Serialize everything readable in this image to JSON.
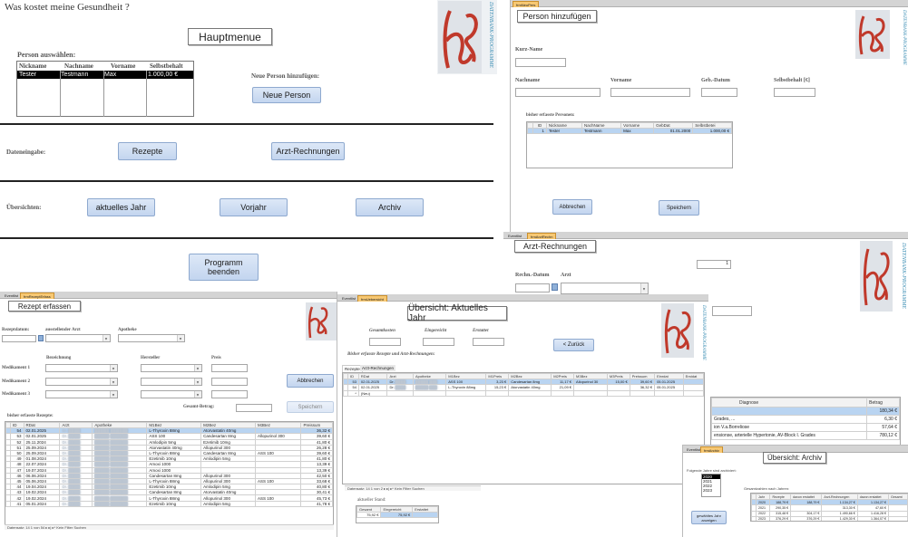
{
  "main": {
    "question": "Was kostet meine Gesundheit ?",
    "menu_title": "Hauptmenue",
    "person_label": "Person auswählen:",
    "person_columns": [
      "Nickname",
      "Nachname",
      "Vorname",
      "Selbstbehalt"
    ],
    "person_rows": [
      [
        "Tester",
        "Testmann",
        "Max",
        "1.000,00 €"
      ]
    ],
    "new_person_label": "Neue Person hinzufügen:",
    "new_person_button": "Neue Person",
    "data_entry_label": "Dateneingabe:",
    "recipes_button": "Rezepte",
    "doctor_bills_button": "Arzt-Rechnungen",
    "overviews_label": "Übersichten:",
    "current_year_button": "aktuelles Jahr",
    "prev_year_button": "Vorjahr",
    "archive_button": "Archiv",
    "quit_button": "Programm beenden"
  },
  "logo": {
    "text": "DATENBANK-PROGRAMME",
    "color": "#c0392b",
    "text_color": "#3d8fb5"
  },
  "person_form": {
    "tab": "frmNeuPers",
    "title": "Person hinzufügen",
    "kurzname_label": "Kurz-Name",
    "nachname_label": "Nachname",
    "vorname_label": "Vorname",
    "geb_label": "Geb.-Datum",
    "selbst_label": "Selbstbehalt [€]",
    "existing_label": "bisher erfasste Personen:",
    "columns": [
      "ID",
      "Nickname",
      "NachName",
      "Vorname",
      "GebDat",
      "Selbstbetei"
    ],
    "row": [
      "1",
      "Tester",
      "Testmann",
      "Max",
      "01.01.2000",
      "1.000,00 €"
    ],
    "cancel": "Abbrechen",
    "save": "Speichern"
  },
  "arzt_form": {
    "tabs": [
      "Eventlist",
      "frmArztRechn"
    ],
    "title": "Arzt-Rechnungen",
    "counter": "1",
    "date_label": "Rechn.-Datum",
    "doctor_label": "Arzt"
  },
  "rezept_form": {
    "tabs": [
      "Eventlist",
      "frmRezeptErfass"
    ],
    "title": "Rezept erfassen",
    "date_label": "Rezeptdatum:",
    "doctor_label": "ausstellender Arzt",
    "pharmacy_label": "Apotheke",
    "name_label": "Bezeichnung",
    "maker_label": "Hersteller",
    "price_label": "Preis",
    "med1": "Medikament 1",
    "med2": "Medikament 2",
    "med3": "Medikament 3",
    "total_label": "Gesamt-Betrag:",
    "cancel": "Abbrechen",
    "save": "Speichern",
    "existing_label": "bisher erfasste Rezepte:",
    "columns": [
      "ID",
      "RDat",
      "Arzt",
      "Apotheke",
      "M1Bez",
      "M2Bez",
      "M3Bez",
      "Preissum"
    ],
    "rows": [
      [
        "54",
        "02.01.2025",
        "Dr.",
        "",
        "L-Thyroxin 88mg",
        "Atorvastatin 40mg",
        "",
        "36,32 €"
      ],
      [
        "53",
        "02.01.2025",
        "Dr.",
        "",
        "ASS 100",
        "Candesartan 8mg",
        "Allopurinol 300",
        "39,60 €"
      ],
      [
        "52",
        "25.11.2024",
        "Dr.",
        "",
        "Amlodipin 5mg",
        "Ezetimib 10mg",
        "",
        "41,80 €"
      ],
      [
        "51",
        "25.09.2024",
        "Dr.",
        "",
        "Atorvastatin 40mg",
        "Allopurinol 300",
        "",
        "26,28 €"
      ],
      [
        "50",
        "25.09.2024",
        "Dr.",
        "",
        "L-Thyroxin 88mg",
        "Candesartan 8mg",
        "ASS 100",
        "39,60 €"
      ],
      [
        "49",
        "01.08.2024",
        "Dr.",
        "",
        "Ezetimib 10mg",
        "Amlodipin 5mg",
        "",
        "41,80 €"
      ],
      [
        "48",
        "22.07.2024",
        "Dr.",
        "",
        "Amoxi 1000",
        "",
        "",
        "13,39 €"
      ],
      [
        "47",
        "19.07.2024",
        "Dr.",
        "",
        "Amoxi 1000",
        "",
        "",
        "13,39 €"
      ],
      [
        "46",
        "06.06.2024",
        "Dr.",
        "",
        "Candesartan 8mg",
        "Allopurinol 300",
        "",
        "42,50 €"
      ],
      [
        "45",
        "05.06.2024",
        "Dr.",
        "",
        "L-Thyroxin 88mg",
        "Allopurinol 300",
        "ASS 100",
        "33,68 €"
      ],
      [
        "44",
        "19.04.2024",
        "Dr.",
        "",
        "Ezetimib 10mg",
        "Amlodipin 5mg",
        "",
        "40,80 €"
      ],
      [
        "43",
        "19.02.2024",
        "Dr.",
        "",
        "Candesartan 8mg",
        "Atorvastatin 40mg",
        "",
        "30,41 €"
      ],
      [
        "42",
        "19.02.2024",
        "Dr.",
        "",
        "L-Thyroxin 88mg",
        "Allopurinol 300",
        "ASS 100",
        "45,73 €"
      ],
      [
        "41",
        "05.01.2024",
        "Dr.",
        "",
        "Ezetimib 10mg",
        "Amlodipin 5mg",
        "",
        "41,78 €"
      ]
    ],
    "status": "Datensatz: 14 1 von 54 ▸ ▸| ▸* Kein Filter  Suchen"
  },
  "uebersicht": {
    "tabs": [
      "Eventlist",
      "frmUebersicht"
    ],
    "title": "Übersicht: Aktuelles Jahr",
    "gesamt_label": "Gesamtkosten",
    "eigen_label": "Eingereicht",
    "erstattet_label": "Erstattet",
    "back_button": "< Zurück",
    "sub_label": "Bisher erfasste Rezepte und Arzt-Rechnungen:",
    "subtabs": [
      "Rezepte",
      "Arzt-Rechnungen"
    ],
    "columns": [
      "ID",
      "RDat",
      "Arzt",
      "Apotheke",
      "M1Bez",
      "M1Preis",
      "M2Bez",
      "M2Preis",
      "M3Bez",
      "M3Preis",
      "Preissum",
      "Einrdat",
      "Erstdat"
    ],
    "rows": [
      [
        "53",
        "02.01.2025",
        "Dr.",
        "",
        "ASS 100",
        "3,23 €",
        "Candesartan 8mg",
        "11,17 €",
        "Allopurinol 30",
        "15,00 €",
        "39,60 €",
        "05.01.2025",
        ""
      ],
      [
        "54",
        "02.01.2025",
        "Dr.",
        "",
        "L-Thyroxin 88mg",
        "15,23 €",
        "Atorvastatin 40mg",
        "21,09 €",
        "",
        "",
        "36,32 €",
        "05.01.2025",
        ""
      ],
      [
        "*",
        "(Neu)",
        "",
        "",
        "",
        "",
        "",
        "",
        "",
        "",
        "",
        "",
        ""
      ]
    ],
    "status": "Datensatz: 14 1 von 2 ▸ ▸| ▸* Kein Filter  Suchen",
    "aktuell_label": "aktueller Stand:",
    "mini_columns": [
      "Gesamt",
      "Eingereicht",
      "Erstattet"
    ],
    "mini_row": [
      "75,92 €",
      "75,92 €",
      ""
    ]
  },
  "diagnose": {
    "columns": [
      "Diagnose",
      "Betrag"
    ],
    "rows": [
      [
        "",
        "180,34 €"
      ],
      [
        "Grades, ...",
        "6,30 €"
      ],
      [
        "ion V.a.Borreliose",
        "57,64 €"
      ],
      [
        "ensionse, arterielle Hypertonie, AV-Block I. Grades",
        "780,12 €"
      ]
    ]
  },
  "archiv": {
    "tabs": [
      "Eventlist",
      "frmArchiv"
    ],
    "title": "Übersicht: Archiv",
    "select_label": "Folgende Jahre sind archiviert:",
    "years": [
      "2020",
      "2021",
      "2022",
      "2023"
    ],
    "show_button": "gewähltes Jahr anzeigen",
    "totals_label": "Gesamtzahlen nach Jahren:",
    "columns": [
      "Jahr",
      "Rezepte",
      "davon erstattet",
      "Arzt-Rechnungen",
      "davon erstattet",
      "Gesamt"
    ],
    "rows": [
      [
        "2020",
        "188,79 €",
        "188,79 €",
        "1.134,27 €",
        "1.134,27 €",
        ""
      ],
      [
        "2021",
        "290,35 €",
        "",
        "313,30 €",
        "47,60 €",
        ""
      ],
      [
        "2022",
        "315,48 €",
        "304,17 €",
        "1.490,66 €",
        "1.416,28 €",
        ""
      ],
      [
        "2023",
        "376,29 €",
        "376,29 €",
        "1.429,30 €",
        "1.364,07 €",
        ""
      ]
    ]
  }
}
